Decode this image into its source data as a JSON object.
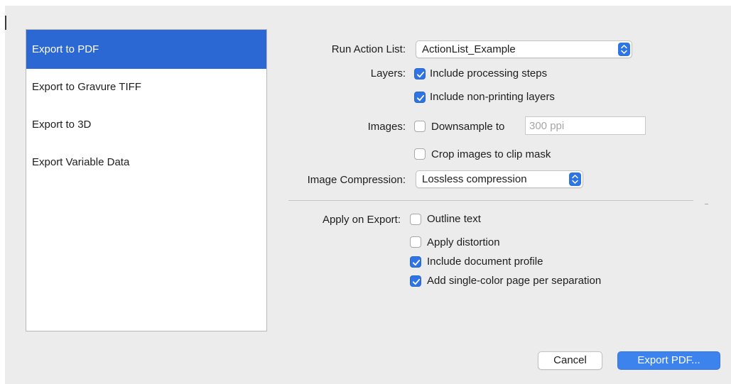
{
  "sidebar": {
    "items": [
      {
        "label": "Export to PDF",
        "selected": true
      },
      {
        "label": "Export to Gravure TIFF",
        "selected": false
      },
      {
        "label": "Export to 3D",
        "selected": false
      },
      {
        "label": "Export Variable Data",
        "selected": false
      }
    ]
  },
  "settings": {
    "action_list": {
      "label": "Run Action List:",
      "value": "ActionList_Example"
    },
    "layers": {
      "label": "Layers:",
      "options": [
        {
          "label": "Include processing steps",
          "checked": true
        },
        {
          "label": "Include non-printing layers",
          "checked": true
        }
      ]
    },
    "images": {
      "label": "Images:",
      "downsample": {
        "label": "Downsample to",
        "checked": false,
        "placeholder": "300 ppi"
      },
      "crop": {
        "label": "Crop images to clip mask",
        "checked": false
      }
    },
    "compression": {
      "label": "Image Compression:",
      "value": "Lossless compression"
    },
    "apply_on_export": {
      "label": "Apply on Export:",
      "options": [
        {
          "label": "Outline text",
          "checked": false
        },
        {
          "label": "Apply distortion",
          "checked": false
        },
        {
          "label": "Include document profile",
          "checked": true
        },
        {
          "label": "Add single-color page per separation",
          "checked": true
        }
      ]
    }
  },
  "buttons": {
    "cancel": "Cancel",
    "export": "Export PDF..."
  },
  "icons": {
    "checkmark": "checkmark-icon",
    "stepper": "updown-chevron-icon"
  },
  "colors": {
    "accent": "#2f74e4",
    "selection": "#2b68d4",
    "primary_button": "#3c83ee"
  }
}
